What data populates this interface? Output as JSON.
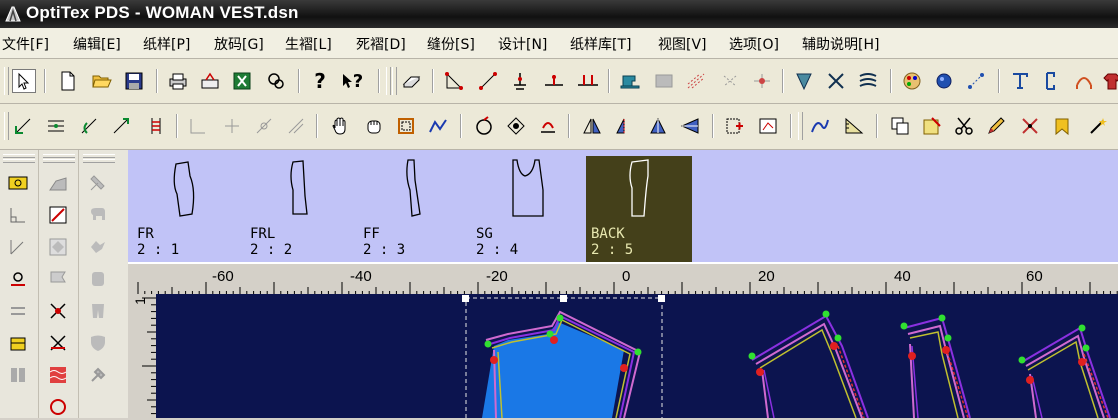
{
  "window": {
    "title": "OptiTex PDS - WOMAN VEST.dsn"
  },
  "menu": {
    "items": [
      "文件[F]",
      "编辑[E]",
      "纸样[P]",
      "放码[G]",
      "生褶[L]",
      "死褶[D]",
      "缝份[S]",
      "设计[N]",
      "纸样库[T]",
      "视图[V]",
      "选项[O]",
      "辅助说明[H]"
    ]
  },
  "toolbar": {
    "help_label": "?",
    "context_help_label": "?"
  },
  "pieces": [
    {
      "name": "FR",
      "num": "2 : 1"
    },
    {
      "name": "FRL",
      "num": "2 : 2"
    },
    {
      "name": "FF",
      "num": "2 : 3"
    },
    {
      "name": "SG",
      "num": "2 : 4"
    },
    {
      "name": "BACK",
      "num": "2 : 5"
    }
  ],
  "ruler": {
    "h_labels": [
      "-60",
      "-40",
      "-20",
      "0",
      "20",
      "40",
      "60"
    ],
    "v_labels": [
      "1"
    ]
  },
  "colors": {
    "canvas": "#0c144f",
    "strip": "#c1c3f7",
    "active_piece": "#44401a",
    "fill": "#1a78e6"
  }
}
